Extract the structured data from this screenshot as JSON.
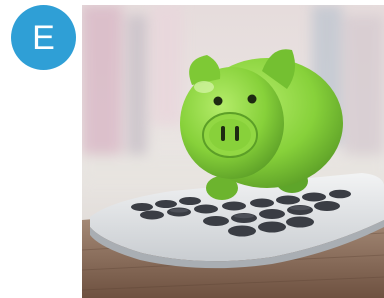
{
  "badge": {
    "letter": "E",
    "color": "#2f9fd6"
  },
  "photo": {
    "icon": "piggy-bank-on-calculator-image",
    "colors": {
      "pig": "#8ad23c",
      "pig_dark": "#5ea52a",
      "calculator": "#e3e6e8",
      "keys": "#3a3d44",
      "table": "#8a6a52",
      "background": "#e9e4e1"
    }
  }
}
